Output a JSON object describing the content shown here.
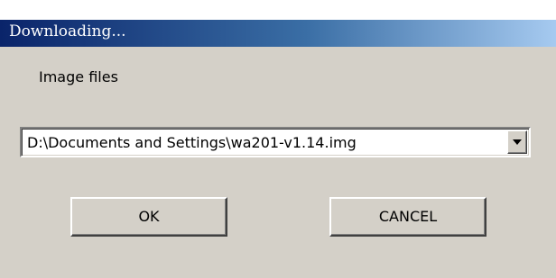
{
  "window": {
    "title": "Downloading..."
  },
  "content": {
    "label": "Image files",
    "combo": {
      "value": "D:\\Documents and Settings\\wa201-v1.14.img",
      "arrow_icon": "chevron-down-icon"
    }
  },
  "buttons": {
    "ok_label": "OK",
    "cancel_label": "CANCEL"
  },
  "colors": {
    "titlebar_start": "#0a246a",
    "titlebar_end": "#a6caf0",
    "face": "#d4d0c8"
  }
}
